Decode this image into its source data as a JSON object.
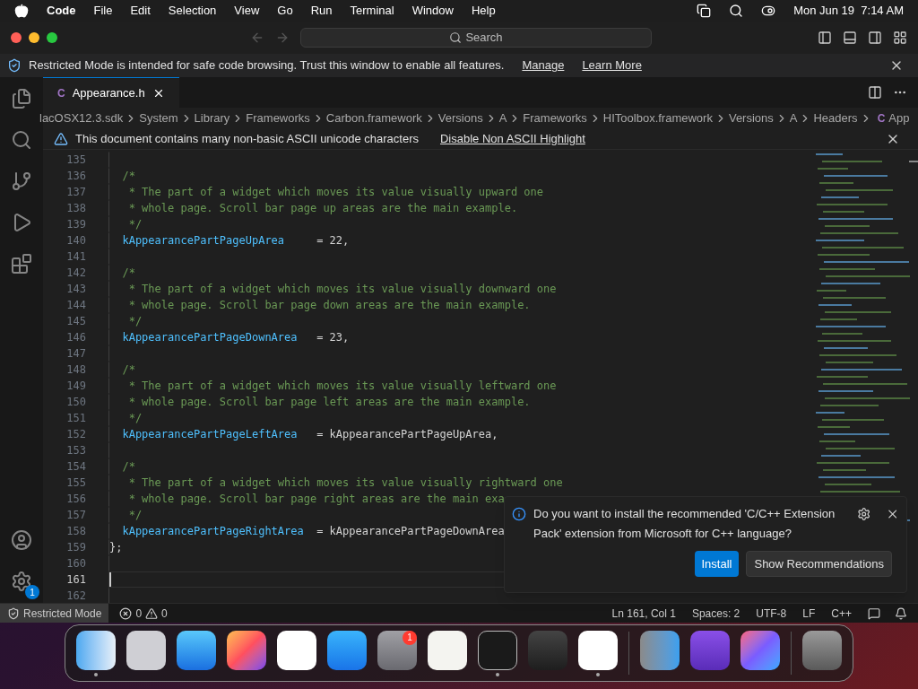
{
  "menu_bar": {
    "app": "Code",
    "items": [
      "File",
      "Edit",
      "Selection",
      "View",
      "Go",
      "Run",
      "Terminal",
      "Window",
      "Help"
    ],
    "clock": "Mon Jun 19  7:14 AM"
  },
  "title_bar": {
    "search": {
      "placeholder": "Search"
    }
  },
  "restricted_banner": {
    "text": "Restricted Mode is intended for safe code browsing. Trust this window to enable all features.",
    "links": [
      "Manage",
      "Learn More"
    ]
  },
  "activity_bar": {
    "settings_badge": "1"
  },
  "tabs": [
    {
      "label": "Appearance.h",
      "icon": "C",
      "selected": true
    }
  ],
  "breadcrumbs": [
    "lacOSX12.3.sdk",
    "System",
    "Library",
    "Frameworks",
    "Carbon.framework",
    "Versions",
    "A",
    "Frameworks",
    "HIToolbox.framework",
    "Versions",
    "A",
    "Headers"
  ],
  "breadcrumb_file": {
    "icon": "C",
    "label": "App"
  },
  "ascii_warning": {
    "text": "This document contains many non-basic ASCII unicode characters",
    "action": "Disable Non ASCII Highlight"
  },
  "code_lines": [
    {
      "number": "135",
      "kind": "blank",
      "current": false
    },
    {
      "number": "136",
      "kind": "comment",
      "text": "/*",
      "current": false
    },
    {
      "number": "137",
      "kind": "comment",
      "text": " * The part of a widget which moves its value visually upward one",
      "current": false
    },
    {
      "number": "138",
      "kind": "comment",
      "text": " * whole page. Scroll bar page up areas are the main example.",
      "current": false
    },
    {
      "number": "139",
      "kind": "comment",
      "text": " */",
      "current": false
    },
    {
      "number": "140",
      "kind": "assign",
      "name": "kAppearancePartPageUpArea",
      "value": "= 22,",
      "current": false
    },
    {
      "number": "141",
      "kind": "blank",
      "current": false
    },
    {
      "number": "142",
      "kind": "comment",
      "text": "/*",
      "current": false
    },
    {
      "number": "143",
      "kind": "comment",
      "text": " * The part of a widget which moves its value visually downward one",
      "current": false
    },
    {
      "number": "144",
      "kind": "comment",
      "text": " * whole page. Scroll bar page down areas are the main example.",
      "current": false
    },
    {
      "number": "145",
      "kind": "comment",
      "text": " */",
      "current": false
    },
    {
      "number": "146",
      "kind": "assign",
      "name": "kAppearancePartPageDownArea",
      "value": "= 23,",
      "current": false
    },
    {
      "number": "147",
      "kind": "blank",
      "current": false
    },
    {
      "number": "148",
      "kind": "comment",
      "text": "/*",
      "current": false
    },
    {
      "number": "149",
      "kind": "comment",
      "text": " * The part of a widget which moves its value visually leftward one",
      "current": false
    },
    {
      "number": "150",
      "kind": "comment",
      "text": " * whole page. Scroll bar page left areas are the main example.",
      "current": false
    },
    {
      "number": "151",
      "kind": "comment",
      "text": " */",
      "current": false
    },
    {
      "number": "152",
      "kind": "assign",
      "name": "kAppearancePartPageLeftArea",
      "value": "= kAppearancePartPageUpArea,",
      "current": false
    },
    {
      "number": "153",
      "kind": "blank",
      "current": false
    },
    {
      "number": "154",
      "kind": "comment",
      "text": "/*",
      "current": false
    },
    {
      "number": "155",
      "kind": "comment",
      "text": " * The part of a widget which moves its value visually rightward one",
      "current": false
    },
    {
      "number": "156",
      "kind": "comment",
      "text": " * whole page. Scroll bar page right areas are the main exa",
      "current": false
    },
    {
      "number": "157",
      "kind": "comment",
      "text": " */",
      "current": false
    },
    {
      "number": "158",
      "kind": "assign",
      "name": "kAppearancePartPageRightArea",
      "value": "= kAppearancePartPageDownArea",
      "current": false
    },
    {
      "number": "159",
      "kind": "close",
      "text": "};",
      "current": false
    },
    {
      "number": "160",
      "kind": "blank",
      "current": false
    },
    {
      "number": "161",
      "kind": "blank",
      "current": true
    },
    {
      "number": "162",
      "kind": "blank",
      "current": false
    }
  ],
  "notification": {
    "message": "Do you want to install the recommended 'C/C++ Extension Pack' extension from Microsoft for C++ language?",
    "buttons": [
      {
        "label": "Install",
        "primary": true
      },
      {
        "label": "Show Recommendations",
        "primary": false
      }
    ]
  },
  "status_bar": {
    "mode": "Restricted Mode",
    "errors": "0",
    "warnings": "0",
    "right": [
      "Ln 161, Col 1",
      "Spaces: 2",
      "UTF-8",
      "LF",
      "C++"
    ]
  },
  "dock": [
    {
      "kind": "finder",
      "running": true
    },
    {
      "kind": "launchpad",
      "running": false
    },
    {
      "kind": "safari",
      "running": false
    },
    {
      "kind": "firefox",
      "running": false
    },
    {
      "kind": "chrome",
      "running": false
    },
    {
      "kind": "appstore",
      "running": false
    },
    {
      "kind": "settings",
      "running": false,
      "badge": "1"
    },
    {
      "kind": "textedit",
      "running": false
    },
    {
      "kind": "terminal",
      "running": true
    },
    {
      "kind": "garageband",
      "running": false
    },
    {
      "kind": "vscode",
      "running": true
    },
    {
      "kind": "separator"
    },
    {
      "kind": "migration",
      "running": false
    },
    {
      "kind": "configurator",
      "running": false
    },
    {
      "kind": "shortcuts",
      "running": false
    },
    {
      "kind": "separator"
    },
    {
      "kind": "trash",
      "running": false
    }
  ]
}
